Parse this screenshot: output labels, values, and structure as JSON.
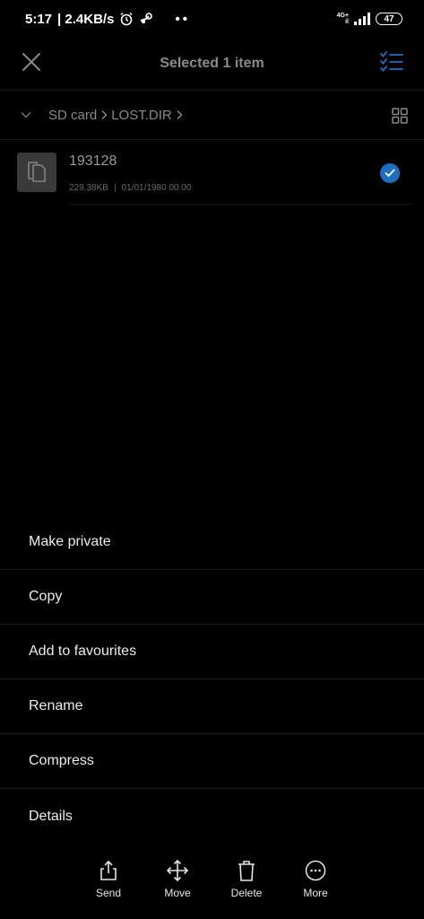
{
  "status_bar": {
    "time": "5:17",
    "speed": "| 2.4KB/s",
    "network_top": "4G+",
    "network_bottom": "il",
    "battery": "47"
  },
  "header": {
    "title": "Selected 1 item"
  },
  "breadcrumb": {
    "items": [
      "SD card",
      "LOST.DIR"
    ]
  },
  "file": {
    "name": "193128",
    "size": "229.38KB",
    "separator": "|",
    "date": "01/01/1980 00:00",
    "selected": true
  },
  "menu": {
    "items": [
      "Make private",
      "Copy",
      "Add to favourites",
      "Rename",
      "Compress",
      "Details"
    ]
  },
  "actions": {
    "send": "Send",
    "move": "Move",
    "delete": "Delete",
    "more": "More"
  },
  "colors": {
    "accent": "#1f6fc0",
    "background": "#000000",
    "muted_text": "#8a8a8a"
  }
}
